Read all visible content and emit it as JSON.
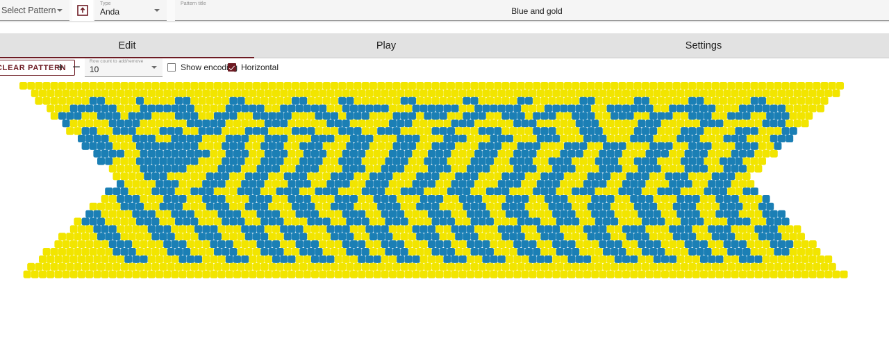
{
  "topbar": {
    "select_pattern": {
      "value": "Select Pattern",
      "icon": "chevron-down-icon"
    },
    "import_button": {
      "icon": "import-pattern-icon"
    },
    "type": {
      "label": "Type",
      "value": "Anda"
    },
    "pattern_title": {
      "label": "Pattern title",
      "value": "Blue and gold"
    }
  },
  "tabs": [
    {
      "label": "Edit",
      "active": true
    },
    {
      "label": "Play",
      "active": false
    },
    {
      "label": "Settings",
      "active": false
    }
  ],
  "toolbar": {
    "clear_pattern_label": "CLEAR PATTERN",
    "add_row_label": "+",
    "remove_row_label": "−",
    "row_count": {
      "label": "Row count to add/remove",
      "value": "10"
    },
    "show_encoding": {
      "label": "Show encoding",
      "checked": false
    },
    "horizontal": {
      "label": "Horizontal",
      "checked": true
    }
  },
  "colors": {
    "accent": "#6d1b23",
    "bead_yellow": "#f2e500",
    "bead_blue": "#1b7fb5",
    "bead_outline": "#111111",
    "tab_bar_bg": "#e2e2e2",
    "field_bg": "#f5f5f5",
    "canvas_bg": "#ffffff"
  },
  "pattern": {
    "stitch": "peyote-odd-count",
    "orientation": "horizontal",
    "rows": 26,
    "columns": 106,
    "bead_width": 11.2,
    "bead_height": 11.2,
    "left_point": true,
    "right_point": true,
    "palette": [
      "#f2e500",
      "#1b7fb5"
    ],
    "grid": [
      "00000000000000000000000000000000000000000000000000000000000000000000000000000000000000000000000000000000",
      "00000000000000000000000000000000000000000000000000000000000000000000000000000000000000000000000000000000",
      "00000000011000010000110000011000000110000110000001100000011000001100000011000001100000110000001100000000",
      "00000011111100011111110000111110011111100111111000111111001111110001111110011111100111111000111111000000",
      "00000111001110111000111001110011111000111011100011101110011100111011100111001110011100111001110011100000",
      "00011100000111100000011111000001110000011100000111000001110000011100000111000001110000011100000111000000",
      "00111000110011100011100111000111000111000111001110000111000111000011100011100001110001110000111000110000",
      "01110001111000111001111000111001110001110011100011100011100011100011100011100011100011100011100011100000",
      "01100011111100011111111000111001110011100011100011100111000111001110001110011100011100111000111001110000",
      "01100111111110011111111100111001110011100111000111001110001110011100011100111000111001110001110001110000",
      "00110011111100011111111000111001110011100111000111001110001110011100111000111001110001110011100011100000",
      "00011100111000011111100001110011100111000111001110001110011100011100111000111001110001110011100011100000",
      "00011100011100001110000011100111001110001110011100011100111000111001110001110011100111000111001110001100",
      "00001110001110000111000111001110001110011100111000111001110001110011100011100111000111001110001110001100",
      "00001110000111000111001110001110011100111000111001110001110011100011100111000111001110001110011100011000",
      "00000111000011100011100111000111001110001110011100011100111000111001110001110011100011100111000111001100",
      "00000011100001110011100011100111000111001110001110011100011100111000111001110001110011100011100111001100",
      "00000001110000111001110001110011100111000111001110001110011100111000111001110001110011100111000111000000",
      "00000000111000011100111000111001110001110011100111000111001110001110011100111000111001110001110011100000",
      "00000000011100001110001110001110011100011100111000111001110001110011100011100111000111001110001110000000",
      "00000000001110000111000111000111001110001110011100011100111000111001110001110011100011100111000111000000",
      "00000000000111000011100011100011100111000111001110001110011100011100111000111001110001110011100011100000",
      "00000000000011100001110001110001110011100011100111000111001110001110011100011100111000111001110001100000",
      "00000000000001110000111000111000111001110001110011100011100111000111001110001110011100011100111000000000",
      "00000000000000000000000000000000000000000000000000000000000000000000000000000000000000000000000000000000",
      "00000000000000000000000000000000000000000000000000000000000000000000000000000000000000000000000000000000"
    ]
  }
}
